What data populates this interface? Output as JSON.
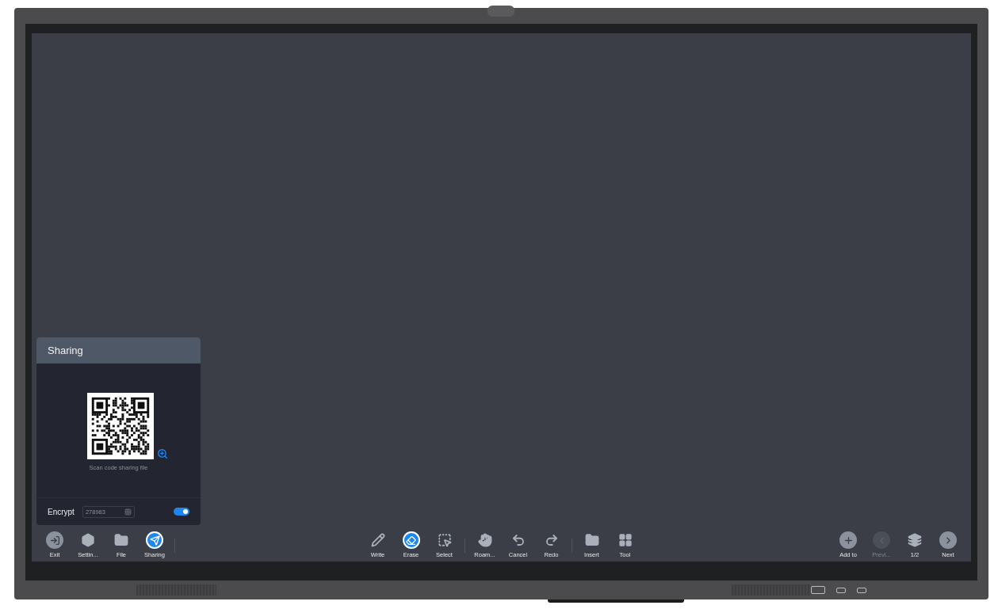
{
  "panel": {
    "title": "Sharing",
    "caption": "Scan code sharing file",
    "encrypt": {
      "label": "Encrypt",
      "value": "278983",
      "on": true
    }
  },
  "toolbar": {
    "left": [
      {
        "label": "Exit",
        "selected": false,
        "disabled": false
      },
      {
        "label": "Settin...",
        "selected": false,
        "disabled": false
      },
      {
        "label": "File",
        "selected": false,
        "disabled": false
      },
      {
        "label": "Sharing",
        "selected": true,
        "disabled": false
      }
    ],
    "center": [
      [
        {
          "label": "Write",
          "selected": false,
          "disabled": false
        },
        {
          "label": "Erase",
          "selected": true,
          "disabled": false
        },
        {
          "label": "Select",
          "selected": false,
          "disabled": false
        }
      ],
      [
        {
          "label": "Roam...",
          "selected": false,
          "disabled": false
        },
        {
          "label": "Cancel",
          "selected": false,
          "disabled": false
        },
        {
          "label": "Redo",
          "selected": false,
          "disabled": false
        }
      ],
      [
        {
          "label": "Insert",
          "selected": false,
          "disabled": false
        },
        {
          "label": "Tool",
          "selected": false,
          "disabled": false
        }
      ]
    ],
    "right": [
      {
        "label": "Add to",
        "selected": false,
        "disabled": false
      },
      {
        "label": "Previ...",
        "selected": false,
        "disabled": true
      },
      {
        "label": "1/2",
        "selected": false,
        "disabled": false
      },
      {
        "label": "Next",
        "selected": false,
        "disabled": false
      }
    ]
  }
}
